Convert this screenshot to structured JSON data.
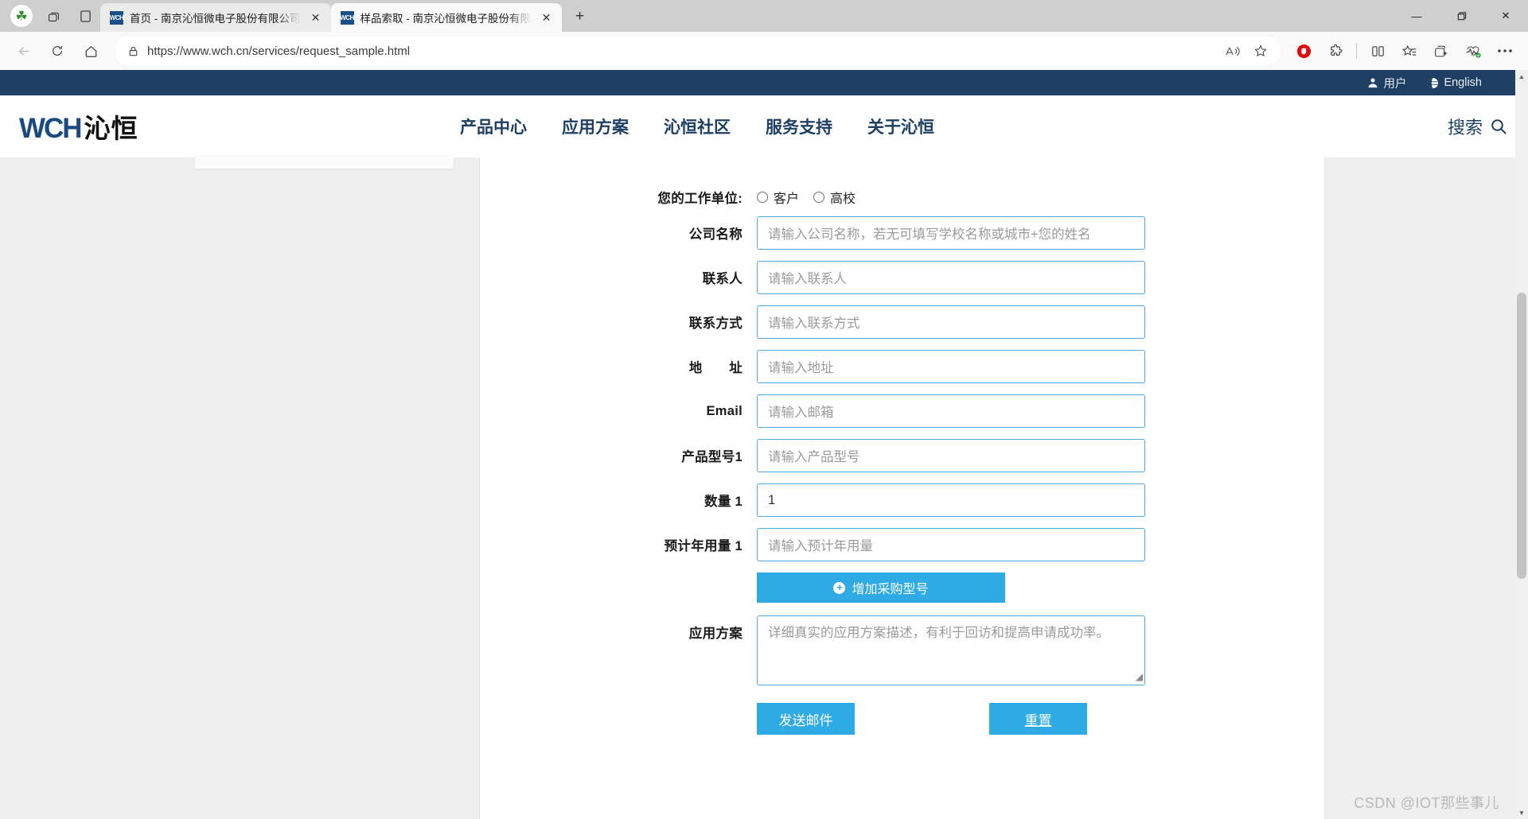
{
  "browser": {
    "tabs": [
      {
        "favicon": "wch-favicon",
        "title": "首页 - 南京沁恒微电子股份有限公司",
        "active": false
      },
      {
        "favicon": "wch-favicon",
        "title": "样品索取 - 南京沁恒微电子股份有限公司",
        "active": true
      }
    ],
    "new_tab_label": "+",
    "window_controls": {
      "minimize": "—",
      "maximize": "❐",
      "close": "✕"
    },
    "address": {
      "url": "https://www.wch.cn/services/request_sample.html",
      "lock_icon": "lock-icon"
    },
    "nav_icons": [
      "back-arrow-icon",
      "reload-icon",
      "home-icon"
    ],
    "omnibox_icons": [
      "read-aloud-icon",
      "favorite-star-icon"
    ],
    "toolbar_icons": [
      "adblock-shield-icon",
      "extensions-puzzle-icon",
      "split-screen-icon",
      "favorites-icon",
      "collections-icon",
      "browser-essentials-icon",
      "settings-more-icon"
    ],
    "left_icons": [
      "clover-icon",
      "tab-actions-icon",
      "copilot-sidebar-icon"
    ]
  },
  "site": {
    "topbar": {
      "user_label": "用户",
      "user_icon": "person-icon",
      "language_label": "English",
      "language_icon": "globe-icon"
    },
    "logo": {
      "mark": "WCH",
      "name": "沁恒"
    },
    "nav": [
      {
        "label": "产品中心"
      },
      {
        "label": "应用方案"
      },
      {
        "label": "沁恒社区"
      },
      {
        "label": "服务支持"
      },
      {
        "label": "关于沁恒"
      }
    ],
    "search": {
      "label": "搜索",
      "icon": "search-icon"
    }
  },
  "form": {
    "work_unit": {
      "label": "您的工作单位:",
      "options": [
        {
          "label": "客户",
          "selected": false
        },
        {
          "label": "高校",
          "selected": false
        }
      ]
    },
    "fields": [
      {
        "label": "公司名称",
        "placeholder": "请输入公司名称，若无可填写学校名称或城市+您的姓名",
        "value": ""
      },
      {
        "label": "联系人",
        "placeholder": "请输入联系人",
        "value": ""
      },
      {
        "label": "联系方式",
        "placeholder": "请输入联系方式",
        "value": ""
      },
      {
        "label": "地　　址",
        "placeholder": "请输入地址",
        "value": ""
      },
      {
        "label": "Email",
        "placeholder": "请输入邮箱",
        "value": ""
      },
      {
        "label": "产品型号1",
        "placeholder": "请输入产品型号",
        "value": ""
      },
      {
        "label": "数量 1",
        "placeholder": "",
        "value": "1"
      },
      {
        "label": "预计年用量 1",
        "placeholder": "请输入预计年用量",
        "value": ""
      }
    ],
    "add_model_button": {
      "label": "增加采购型号",
      "icon": "plus-circle-icon"
    },
    "application": {
      "label": "应用方案",
      "placeholder": "详细真实的应用方案描述，有利于回访和提高申请成功率。",
      "value": ""
    },
    "submit_button": "发送邮件",
    "reset_button": "重置"
  },
  "watermark": "CSDN @IOT那些事儿",
  "colors": {
    "site_navy": "#1d3f63",
    "accent_blue": "#2eaae5",
    "input_border": "#4fa8e0",
    "logo_blue": "#1a4a80"
  }
}
